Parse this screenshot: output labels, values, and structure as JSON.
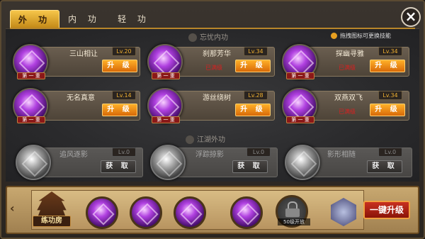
{
  "tabs": [
    {
      "label": "外 功",
      "active": true
    },
    {
      "label": "内 功",
      "active": false
    },
    {
      "label": "轻 功",
      "active": false
    }
  ],
  "sections": {
    "inner": "忘忧内功",
    "outer": "江湖外功"
  },
  "hint": "拖拽图标可更换技能",
  "skills": [
    {
      "name": "三山相让",
      "level": "Lv.20",
      "action": "升 级",
      "tag": "第 一 重",
      "warn": ""
    },
    {
      "name": "刹那芳华",
      "level": "Lv.34",
      "action": "升 级",
      "tag": "第 一 重",
      "warn": "已满级"
    },
    {
      "name": "探幽寻雅",
      "level": "Lv.34",
      "action": "升 级",
      "tag": "第 一 重",
      "warn": "已满级"
    },
    {
      "name": "无名真意",
      "level": "Lv.14",
      "action": "升 级",
      "tag": "第 一 重",
      "warn": ""
    },
    {
      "name": "游丝绕树",
      "level": "Lv.28",
      "action": "升 级",
      "tag": "第 一 重",
      "warn": ""
    },
    {
      "name": "双燕双飞",
      "level": "Lv.34",
      "action": "升 级",
      "tag": "第 一 重",
      "warn": "已满级"
    },
    {
      "name": "追风逐影",
      "level": "Lv.0",
      "action": "获 取",
      "tag": "",
      "warn": ""
    },
    {
      "name": "浮踪掠影",
      "level": "Lv.0",
      "action": "获 取",
      "tag": "",
      "warn": ""
    },
    {
      "name": "影形相随",
      "level": "Lv.0",
      "action": "获 取",
      "tag": "",
      "warn": ""
    }
  ],
  "bottom": {
    "tower_label": "练功房",
    "lock_text": "50级开放",
    "upgrade_all": "一键升级"
  },
  "colors": {
    "tab_active": "#e8a820",
    "upgrade_button": "#e07a10",
    "upgrade_all_button": "#a8200e",
    "warn_text": "#d82020"
  }
}
